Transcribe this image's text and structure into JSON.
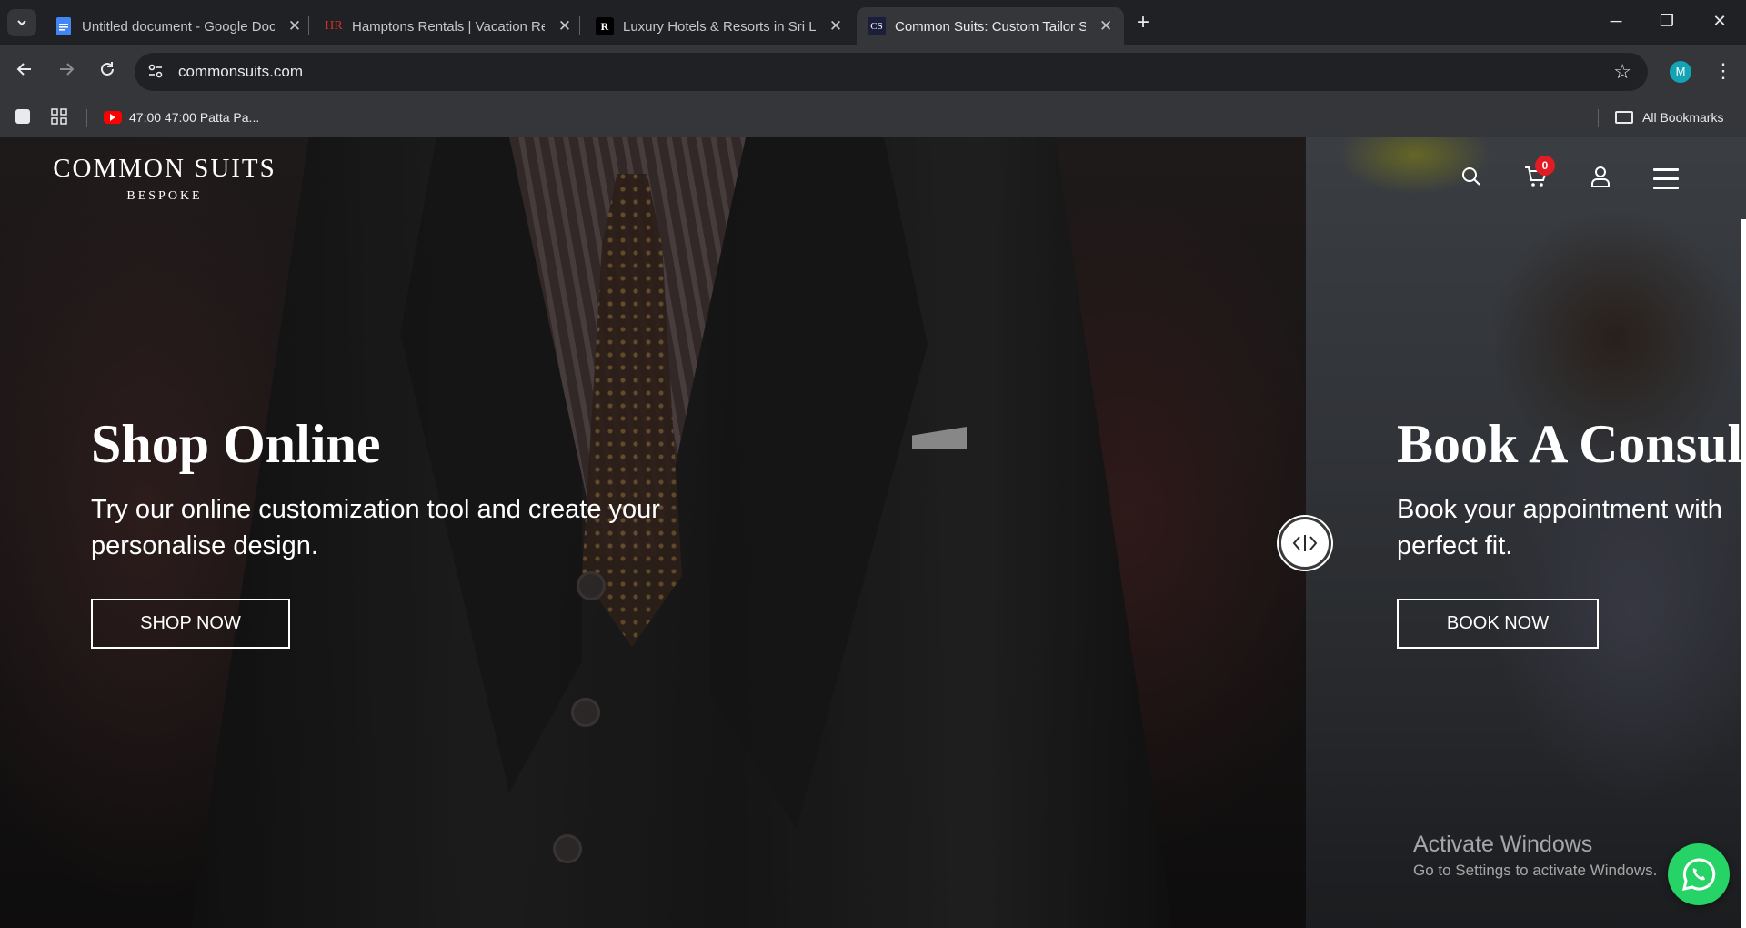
{
  "browser": {
    "tabs": [
      {
        "title": "Untitled document - Google Docs",
        "icon": "google-docs-icon",
        "active": false
      },
      {
        "title": "Hamptons Rentals | Vacation Rentals",
        "icon": "hr-icon",
        "favicon_text": "HR",
        "active": false
      },
      {
        "title": "Luxury Hotels & Resorts in Sri Lanka",
        "icon": "r-icon",
        "favicon_text": "R",
        "active": false
      },
      {
        "title": "Common Suits: Custom Tailor Suits",
        "icon": "cs-icon",
        "favicon_text": "CS",
        "active": true
      }
    ],
    "url": "commonsuits.com",
    "profile_initial": "M",
    "bookmarks": [
      {
        "label": "47:00 47:00 Patta Pa...",
        "icon": "youtube-icon"
      }
    ],
    "all_bookmarks_label": "All Bookmarks"
  },
  "site": {
    "logo_name": "COMMON SUITS",
    "logo_sub": "BESPOKE",
    "cart_count": "0",
    "left_panel": {
      "title": "Shop Online",
      "text_line1": "Try our online customization tool and create your",
      "text_line2": "personalise design.",
      "button": "SHOP NOW"
    },
    "right_panel": {
      "title": "Book A Consult",
      "text_line1": "Book your appointment with",
      "text_line2": "perfect fit.",
      "button": "BOOK NOW"
    }
  },
  "os": {
    "activate_title": "Activate Windows",
    "activate_sub": "Go to Settings to activate Windows."
  },
  "colors": {
    "chrome_bg": "#202124",
    "toolbar_bg": "#35363a",
    "cart_badge": "#e31b23",
    "whatsapp": "#25d366"
  }
}
